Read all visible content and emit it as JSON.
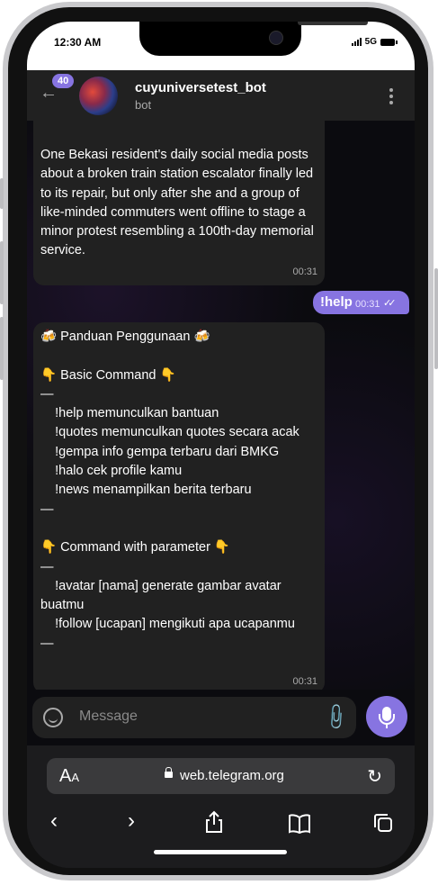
{
  "status_bar": {
    "time": "12:30 AM",
    "network": "5G"
  },
  "header": {
    "unread_badge": "40",
    "title": "cuyuniversetest_bot",
    "subtitle": "bot"
  },
  "messages": [
    {
      "direction": "incoming",
      "text": "One Bekasi resident's daily social media posts about a broken train station escalator finally led to its repair, but only after she and a group of like-minded commuters went offline to stage a minor protest resembling a 100th-day memorial service.",
      "time": "00:31"
    },
    {
      "direction": "outgoing",
      "text": "!help",
      "time": "00:31"
    },
    {
      "direction": "incoming",
      "lines": [
        "🍻 Panduan Penggunaan 🍻",
        "",
        "👇 Basic Command 👇",
        "—",
        "    !help memunculkan bantuan",
        "    !quotes memunculkan quotes secara acak",
        "    !gempa info gempa terbaru dari BMKG",
        "    !halo cek profile kamu",
        "    !news menampilkan berita terbaru",
        "—",
        "",
        "👇 Command with parameter 👇",
        "—",
        "    !avatar [nama] generate gambar avatar buatmu",
        "    !follow [ucapan] mengikuti apa ucapanmu",
        "—"
      ],
      "time": "00:31"
    }
  ],
  "composer": {
    "placeholder": "Message"
  },
  "browser": {
    "aa_label": "A",
    "aa_small": "A",
    "domain": "web.telegram.org"
  },
  "colors": {
    "accent": "#8774e1",
    "bubble_in": "#212121",
    "header": "#212121"
  },
  "icons": [
    "back-arrow-icon",
    "menu-dots-icon",
    "smile-icon",
    "attach-icon",
    "mic-icon",
    "lock-icon",
    "reload-icon",
    "back-icon",
    "forward-icon",
    "share-icon",
    "bookmarks-icon",
    "tabs-icon"
  ]
}
